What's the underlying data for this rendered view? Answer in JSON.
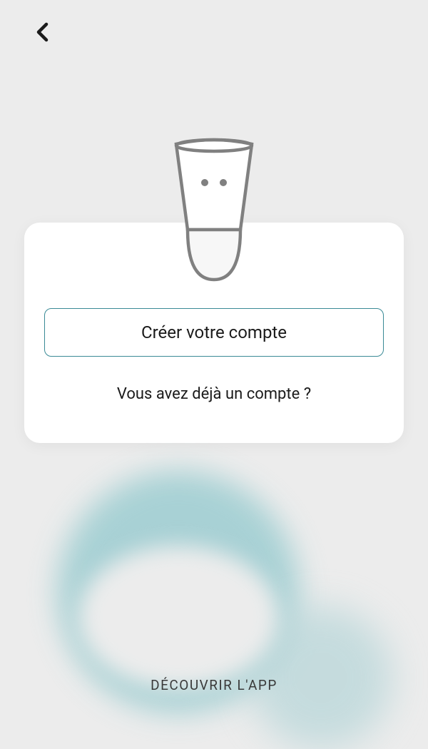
{
  "header": {
    "back_icon": "chevron-left"
  },
  "card": {
    "create_account_label": "Créer votre compte",
    "existing_account_label": "Vous avez déjà un compte ?"
  },
  "footer": {
    "discover_label": "DÉCOUVRIR L'APP"
  },
  "colors": {
    "accent": "#3a8a96",
    "blob": "#9dcdd1",
    "background": "#ececec",
    "card": "#ffffff"
  }
}
